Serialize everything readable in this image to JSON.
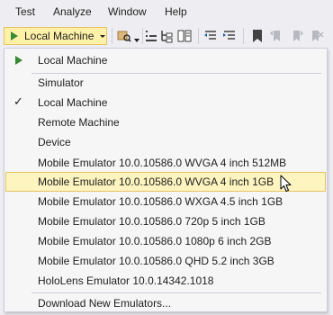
{
  "menubar": [
    "Test",
    "Analyze",
    "Window",
    "Help"
  ],
  "toolbar": {
    "run_target": "Local Machine"
  },
  "dropdown": {
    "items": [
      "Local Machine",
      "Simulator",
      "Local Machine",
      "Remote Machine",
      "Device",
      "Mobile Emulator 10.0.10586.0 WVGA 4 inch 512MB",
      "Mobile Emulator 10.0.10586.0 WVGA 4 inch 1GB",
      "Mobile Emulator 10.0.10586.0 WXGA 4.5 inch 1GB",
      "Mobile Emulator 10.0.10586.0 720p 5 inch 1GB",
      "Mobile Emulator 10.0.10586.0 1080p 6 inch 2GB",
      "Mobile Emulator 10.0.10586.0 QHD 5.2 inch 3GB",
      "HoloLens Emulator 10.0.14342.1018",
      "Download New Emulators..."
    ],
    "checked_glyph": "✓"
  },
  "colors": {
    "accent_run": "#388a34",
    "highlight": "#fdf4bf",
    "highlight_border": "#e5c365"
  }
}
